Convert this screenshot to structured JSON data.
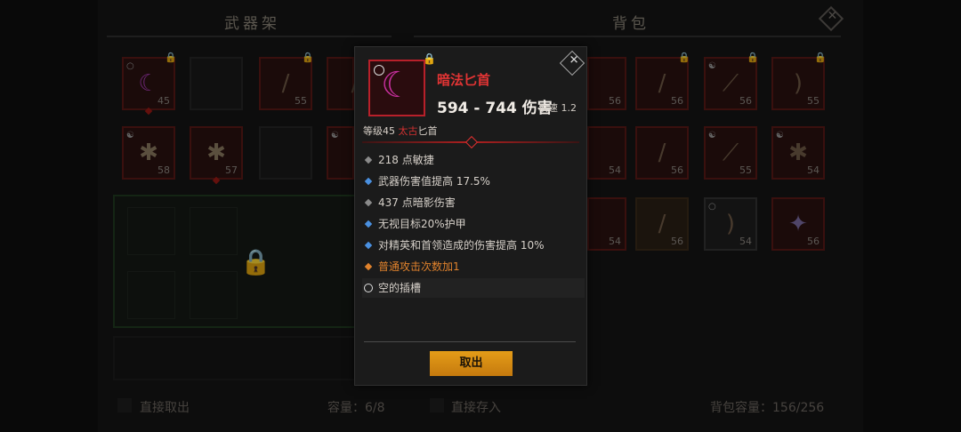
{
  "weapon_rack": {
    "title": "武器架",
    "direct_take_label": "直接取出",
    "capacity_label": "容量：6/8",
    "slots": [
      {
        "level": "45",
        "icon": "purple-dagger-icon"
      },
      {
        "level": "",
        "icon": ""
      },
      {
        "level": "55",
        "icon": "sword-icon"
      },
      {
        "level": "",
        "icon": "sword-icon"
      },
      {
        "level": "58",
        "icon": "claw-icon"
      },
      {
        "level": "57",
        "icon": "claw-icon"
      },
      {
        "level": "",
        "icon": ""
      },
      {
        "level": "",
        "icon": "blade-icon"
      }
    ]
  },
  "backpack": {
    "title": "背包",
    "direct_store_label": "直接存入",
    "capacity_label": "背包容量：156/256",
    "slots": [
      {
        "level": "56"
      },
      {
        "level": "56"
      },
      {
        "level": "56"
      },
      {
        "level": "56"
      },
      {
        "level": "55"
      },
      {
        "level": "54"
      },
      {
        "level": "56"
      },
      {
        "level": "55"
      },
      {
        "level": "54"
      },
      {
        "level": "54"
      },
      {
        "level": "56"
      },
      {
        "level": "54"
      },
      {
        "level": "56"
      }
    ]
  },
  "tooltip": {
    "name": "暗法匕首",
    "damage": "594 - 744 伤害",
    "speed": "攻速 1.2",
    "level_prefix": "等级45 ",
    "type_red": "太古",
    "type_suffix": "匕首",
    "stats": [
      {
        "text": "218 点敏捷",
        "color": "#8a8a8a"
      },
      {
        "text": "武器伤害值提高 17.5%",
        "color": "#4a90e0"
      },
      {
        "text": "437 点暗影伤害",
        "color": "#8a8a8a"
      },
      {
        "text": "无视目标20%护甲",
        "color": "#4a90e0"
      },
      {
        "text": "对精英和首领造成的伤害提高 10%",
        "color": "#4a90e0"
      },
      {
        "text": "普通攻击次数加1",
        "color": "#e0822c"
      }
    ],
    "socket": "空的插槽",
    "button": "取出"
  },
  "colors": {
    "accent_red": "#e23434",
    "button_orange": "#e49c18"
  }
}
